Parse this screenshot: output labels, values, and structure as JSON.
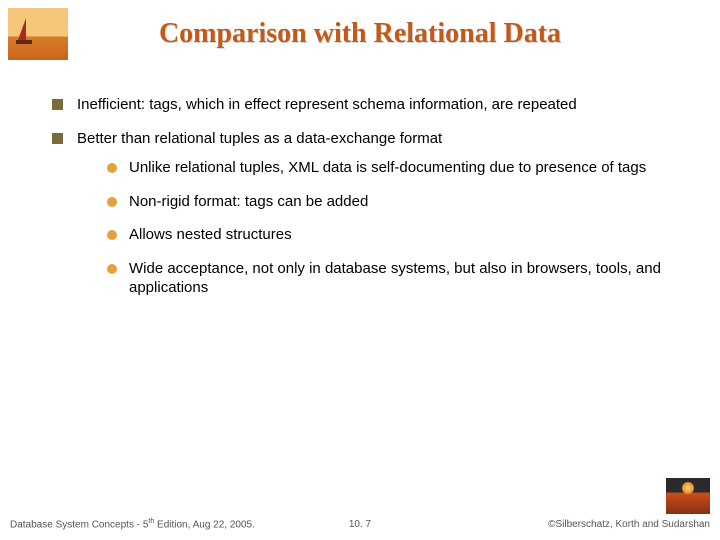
{
  "title": "Comparison with Relational Data",
  "bullets": [
    {
      "text": "Inefficient: tags, which in effect represent schema information, are repeated",
      "sub": []
    },
    {
      "text": "Better than relational tuples as a data-exchange format",
      "sub": [
        "Unlike relational tuples, XML data is self-documenting due to presence of tags",
        "Non-rigid format: tags can be added",
        "Allows nested structures",
        "Wide acceptance, not only in database systems, but also in browsers, tools, and applications"
      ]
    }
  ],
  "footer": {
    "left_prefix": "Database System Concepts - 5",
    "left_sup": "th",
    "left_suffix": " Edition, Aug 22, 2005.",
    "center": "10. 7",
    "right": "©Silberschatz, Korth and Sudarshan"
  }
}
